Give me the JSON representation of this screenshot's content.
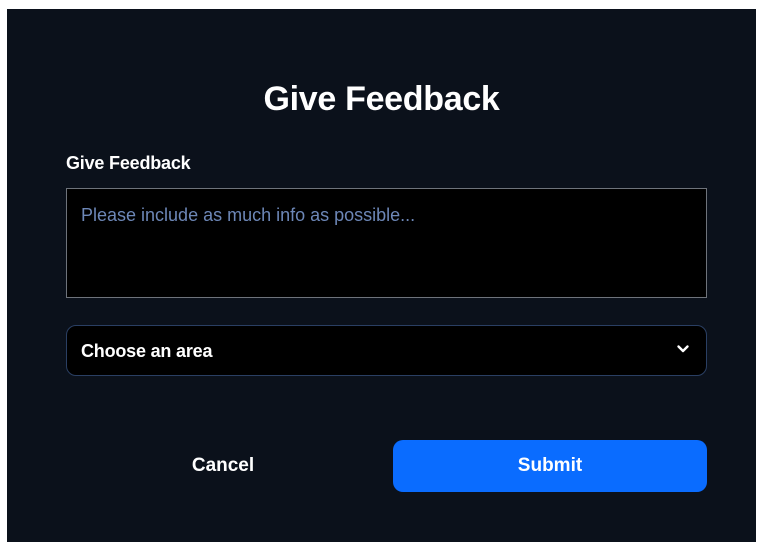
{
  "dialog": {
    "title": "Give Feedback",
    "field_label": "Give Feedback",
    "feedback_input": {
      "value": "",
      "placeholder": "Please include as much info as possible..."
    },
    "area_select": {
      "selected": "Choose an area",
      "icon": "chevron-down-icon"
    },
    "cancel_label": "Cancel",
    "submit_label": "Submit"
  },
  "colors": {
    "background": "#0b111b",
    "input_background": "#000000",
    "placeholder": "#6d87b7",
    "submit_button": "#0a6cff",
    "select_border": "#2a3f63",
    "textarea_border": "#6e737b"
  }
}
